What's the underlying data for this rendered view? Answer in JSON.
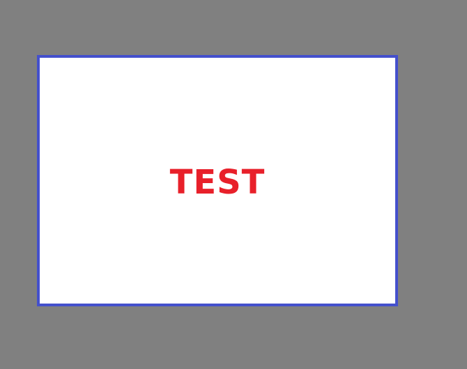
{
  "panel": {
    "label": "TEST"
  },
  "colors": {
    "background": "#808080",
    "panel_fill": "#ffffff",
    "panel_border": "#4450cc",
    "label_text": "#e8202a"
  }
}
